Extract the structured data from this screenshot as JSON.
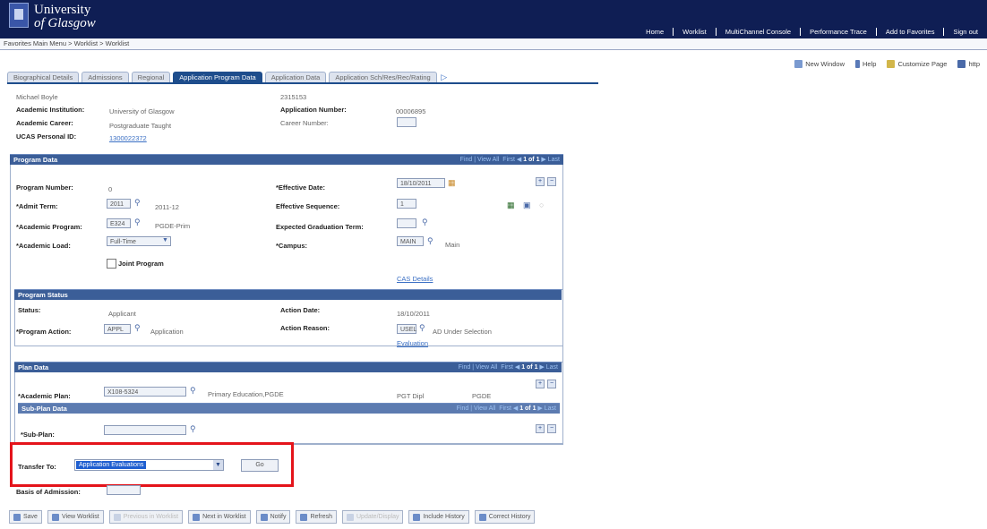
{
  "header": {
    "brand_line1": "University",
    "brand_line2": "of Glasgow",
    "nav": [
      "Home",
      "Worklist",
      "MultiChannel Console",
      "Performance Trace",
      "Add to Favorites",
      "Sign out"
    ]
  },
  "breadcrumb": {
    "text": "Favorites   Main Menu  >  Worklist  >  Worklist"
  },
  "pagelinks": {
    "new_window": "New Window",
    "help": "Help",
    "customize": "Customize Page",
    "http": "http"
  },
  "tabs": [
    "Biographical Details",
    "Admissions",
    "Regional",
    "Application Program Data",
    "Application Data",
    "Application Sch/Res/Rec/Rating"
  ],
  "active_tab": 3,
  "person": {
    "name": "Michael Boyle",
    "id": "2315153",
    "institution_label": "Academic Institution:",
    "institution": "University of Glasgow",
    "app_number_label": "Application Number:",
    "app_number": "00006895",
    "career_label": "Academic Career:",
    "career": "Postgraduate Taught",
    "career_number_label": "Career Number:",
    "ucas_label": "UCAS Personal ID:",
    "ucas": "1300022372"
  },
  "program_data": {
    "title": "Program Data",
    "nav": {
      "find": "Find",
      "view_all": "View All",
      "first": "First",
      "count": "1 of 1",
      "last": "Last"
    },
    "program_number_label": "Program Number:",
    "program_number": "0",
    "effective_date_label": "*Effective Date:",
    "effective_date": "18/10/2011",
    "admit_term_label": "*Admit Term:",
    "admit_term": "2011",
    "admit_term_desc": "2011-12",
    "effective_sequence_label": "Effective Sequence:",
    "effective_sequence": "1",
    "academic_program_label": "*Academic Program:",
    "academic_program": "E324",
    "academic_program_desc": "PGDE-Prim",
    "expected_grad_label": "Expected Graduation Term:",
    "academic_load_label": "*Academic Load:",
    "academic_load": "Full-Time",
    "campus_label": "*Campus:",
    "campus": "MAIN",
    "campus_desc": "Main",
    "joint_program_label": "Joint Program",
    "cas_details": "CAS Details"
  },
  "program_status": {
    "title": "Program Status",
    "status_label": "Status:",
    "status": "Applicant",
    "action_date_label": "Action Date:",
    "action_date": "18/10/2011",
    "program_action_label": "*Program Action:",
    "program_action": "APPL",
    "program_action_desc": "Application",
    "action_reason_label": "Action Reason:",
    "action_reason": "USEL",
    "action_reason_desc": "AD Under Selection",
    "evaluation_link": "Evaluation"
  },
  "plan_data": {
    "title": "Plan Data",
    "nav": {
      "find": "Find",
      "view_all": "View All",
      "first": "First",
      "count": "1 of 1",
      "last": "Last"
    },
    "academic_plan_label": "*Academic Plan:",
    "academic_plan": "X108-5324",
    "academic_plan_desc": "Primary Education,PGDE",
    "plan_type": "PGT Dipl",
    "plan_degree": "PGDE"
  },
  "sub_plan_data": {
    "title": "Sub-Plan Data",
    "nav": {
      "find": "Find",
      "view_all": "View All",
      "first": "First",
      "count": "1 of 1",
      "last": "Last"
    },
    "sub_plan_label": "*Sub-Plan:"
  },
  "transfer": {
    "label": "Transfer To:",
    "selected": "Application Evaluations",
    "go": "Go"
  },
  "basis_label": "Basis of Admission:",
  "toolbar": [
    "Save",
    "View Worklist",
    "Previous in Worklist",
    "Next in Worklist",
    "Notify",
    "Refresh",
    "Update/Display",
    "Include History",
    "Correct History"
  ],
  "toolbar_disabled": [
    2,
    6
  ],
  "colors": {
    "header": "#0f1e54",
    "section": "#3b5e98",
    "highlight": "#e4141b",
    "link": "#3a6fc4"
  }
}
